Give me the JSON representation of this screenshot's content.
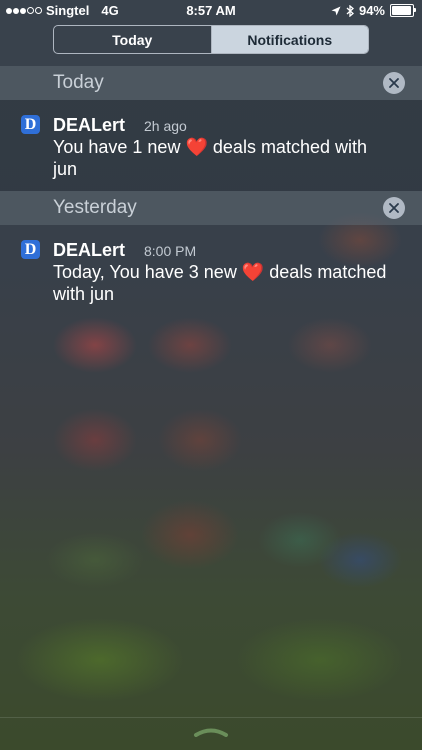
{
  "status_bar": {
    "carrier": "Singtel",
    "network": "4G",
    "time": "8:57 AM",
    "battery": "94%",
    "battery_level": 0.94
  },
  "segments": {
    "today": "Today",
    "notifications": "Notifications"
  },
  "sections": [
    {
      "title": "Today",
      "notifications": [
        {
          "app": "DEALert",
          "icon_letter": "D",
          "time": "2h ago",
          "body_before": "You have 1 new",
          "body_after": "deals matched with jun"
        }
      ]
    },
    {
      "title": "Yesterday",
      "notifications": [
        {
          "app": "DEALert",
          "icon_letter": "D",
          "time": "8:00 PM",
          "body_before": "Today, You have 3 new",
          "body_after": "deals matched with jun"
        }
      ]
    }
  ],
  "heart_glyph": "❤️",
  "colors": {
    "app_icon": "#2f6fd8",
    "heart": "#e32636",
    "segment_active_bg": "#cbd5df"
  }
}
